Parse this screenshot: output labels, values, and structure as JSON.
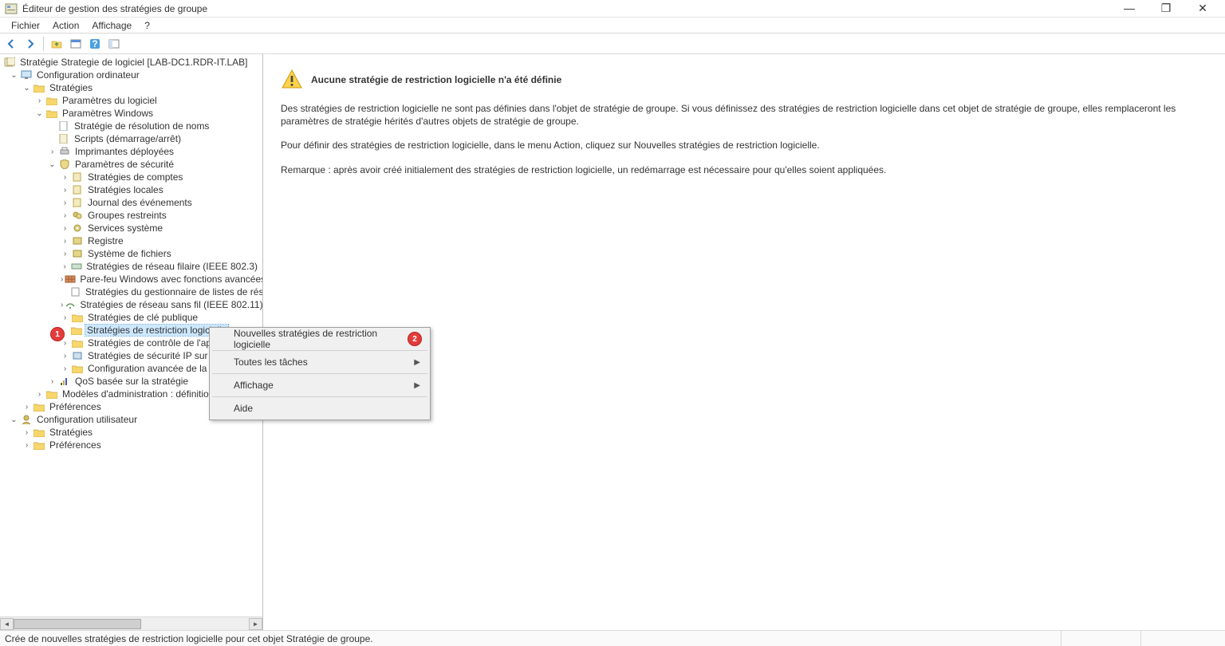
{
  "window": {
    "title": "Éditeur de gestion des stratégies de groupe",
    "minimize": "—",
    "maximize": "❐",
    "close": "✕"
  },
  "menu": {
    "file": "Fichier",
    "action": "Action",
    "view": "Affichage",
    "help": "?"
  },
  "toolbar_icons": {
    "back": "back-arrow-icon",
    "fwd": "forward-arrow-icon",
    "up": "up-folder-icon",
    "props": "properties-icon",
    "help": "help-icon",
    "refresh": "refresh-icon"
  },
  "tree": {
    "root": "Stratégie Strategie de logiciel [LAB-DC1.RDR-IT.LAB]",
    "conf_ordi": "Configuration ordinateur",
    "strategies": "Stratégies",
    "params_logiciel": "Paramètres du logiciel",
    "params_windows": "Paramètres Windows",
    "res_noms": "Stratégie de résolution de noms",
    "scripts": "Scripts (démarrage/arrêt)",
    "imprimantes": "Imprimantes déployées",
    "params_secu": "Paramètres de sécurité",
    "comptes": "Stratégies de comptes",
    "locales": "Stratégies locales",
    "journal": "Journal des événements",
    "groupes": "Groupes restreints",
    "services": "Services système",
    "registre": "Registre",
    "fichiers": "Système de fichiers",
    "filaire": "Stratégies de réseau filaire (IEEE 802.3)",
    "parefeu": "Pare-feu Windows avec fonctions avancées de s",
    "gest_listes": "Stratégies du gestionnaire de listes de réseaux",
    "sansfil": "Stratégies de réseau sans fil (IEEE 802.11)",
    "cle_pub": "Stratégies de clé publique",
    "restriction": "Stratégies de restriction logicielle",
    "controle_app": "Stratégies de contrôle de l'applic",
    "ipsec": "Stratégies de sécurité IP sur Activ",
    "conf_avancee": "Configuration avancée de la strat",
    "qos": "QoS basée sur la stratégie",
    "modeles": "Modèles d'administration : définitions d",
    "preferences1": "Préférences",
    "conf_user": "Configuration utilisateur",
    "strategies2": "Stratégies",
    "preferences2": "Préférences"
  },
  "badges": {
    "one": "1",
    "two": "2"
  },
  "context_menu": {
    "new_srp": "Nouvelles stratégies de restriction logicielle",
    "all_tasks": "Toutes les tâches",
    "view": "Affichage",
    "help": "Aide"
  },
  "content": {
    "title": "Aucune stratégie de restriction logicielle n'a été définie",
    "p1": "Des stratégies de restriction logicielle ne sont pas définies dans l'objet de stratégie de groupe. Si vous définissez des stratégies de restriction logicielle dans cet objet de stratégie de groupe, elles remplaceront les paramètres de stratégie hérités d'autres objets de stratégie de groupe.",
    "p2": "Pour définir des stratégies de restriction logicielle, dans le menu Action, cliquez sur Nouvelles stratégies de restriction logicielle.",
    "p3": "Remarque : après avoir créé initialement des stratégies de restriction logicielle, un redémarrage est nécessaire pour qu'elles soient appliquées."
  },
  "status": "Crée de nouvelles stratégies de restriction logicielle pour cet objet Stratégie de groupe."
}
